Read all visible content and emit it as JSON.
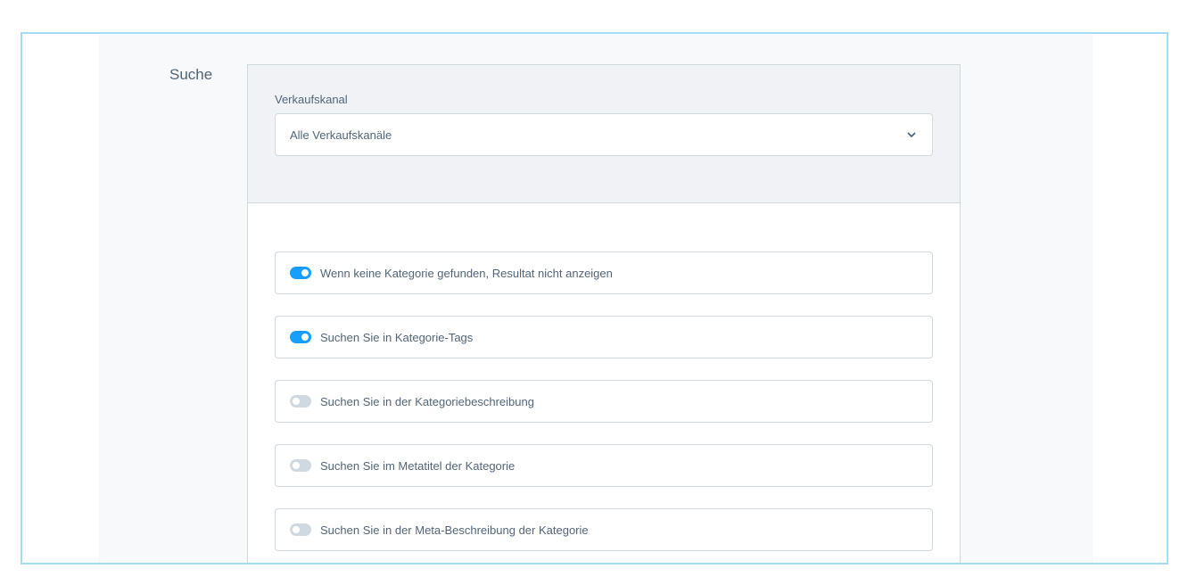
{
  "section": {
    "title": "Suche"
  },
  "sales_channel": {
    "label": "Verkaufskanal",
    "selected": "Alle Verkaufskanäle"
  },
  "toggles": [
    {
      "label": "Wenn keine Kategorie gefunden, Resultat nicht anzeigen",
      "enabled": true
    },
    {
      "label": "Suchen Sie in Kategorie-Tags",
      "enabled": true
    },
    {
      "label": "Suchen Sie in der Kategoriebeschreibung",
      "enabled": false
    },
    {
      "label": "Suchen Sie im Metatitel der Kategorie",
      "enabled": false
    },
    {
      "label": "Suchen Sie in der Meta-Beschreibung der Kategorie",
      "enabled": false
    }
  ],
  "colors": {
    "accent": "#189eff",
    "switch_off": "#d1d9e0",
    "text": "#52667a",
    "frame_border": "#a5dcf5"
  }
}
